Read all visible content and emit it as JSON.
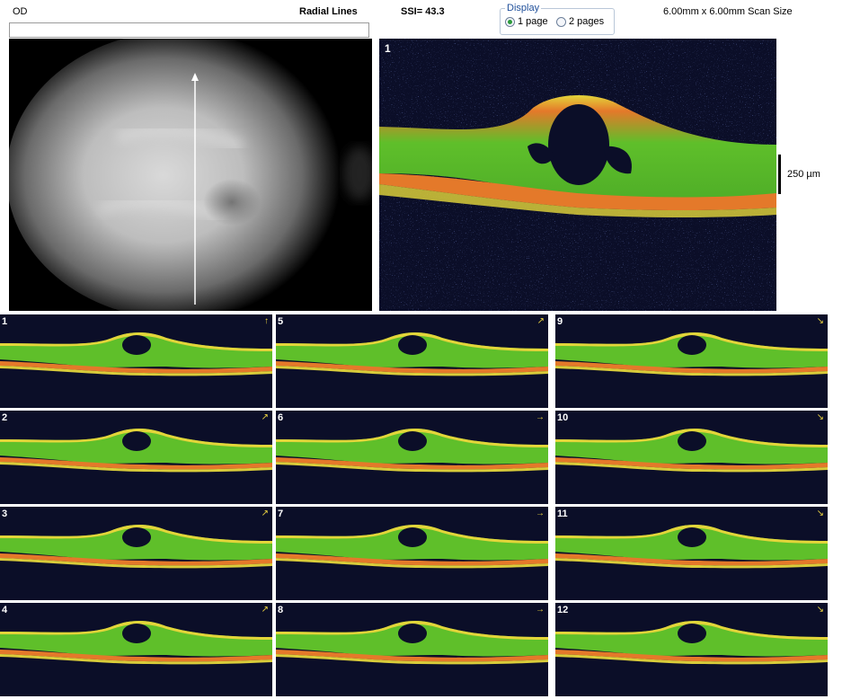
{
  "header": {
    "eye": "OD",
    "scan_type": "Radial Lines",
    "ssi": "SSI= 43.3",
    "scan_size": "6.00mm x 6.00mm Scan Size"
  },
  "display": {
    "legend": "Display",
    "options": [
      {
        "label": "1 page",
        "selected": true
      },
      {
        "label": "2 pages",
        "selected": false
      }
    ]
  },
  "main_scan": {
    "label": "1",
    "scale_label": "250 µm"
  },
  "thumbnails": [
    {
      "label": "1",
      "arrow": "↑"
    },
    {
      "label": "2",
      "arrow": "↗"
    },
    {
      "label": "3",
      "arrow": "↗"
    },
    {
      "label": "4",
      "arrow": "↗"
    },
    {
      "label": "5",
      "arrow": "↗"
    },
    {
      "label": "6",
      "arrow": "→"
    },
    {
      "label": "7",
      "arrow": "→"
    },
    {
      "label": "8",
      "arrow": "→"
    },
    {
      "label": "9",
      "arrow": "↘"
    },
    {
      "label": "10",
      "arrow": "↘"
    },
    {
      "label": "11",
      "arrow": "↘"
    },
    {
      "label": "12",
      "arrow": "↘"
    }
  ],
  "colors": {
    "retina_green": "#5fbf2a",
    "retina_yellow": "#e3d53a",
    "rpe_orange": "#e4792a",
    "background_navy": "#0b0e28"
  }
}
